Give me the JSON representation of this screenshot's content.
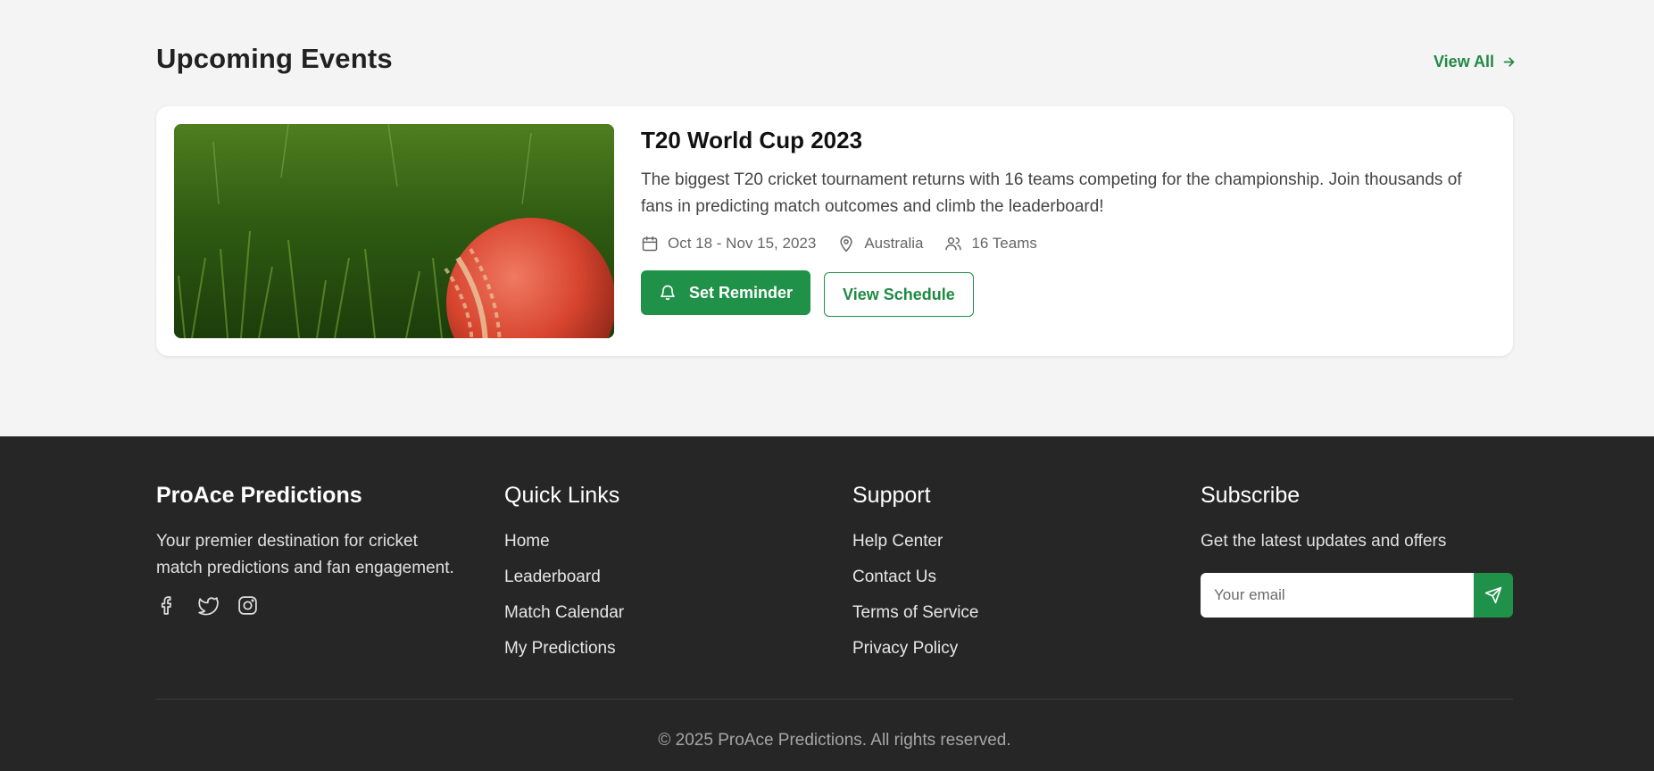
{
  "events": {
    "section_title": "Upcoming Events",
    "view_all_label": "View All",
    "card": {
      "title": "T20 World Cup 2023",
      "description": "The biggest T20 cricket tournament returns with 16 teams competing for the championship. Join thousands of fans in predicting match outcomes and climb the leaderboard!",
      "dates": "Oct 18 - Nov 15, 2023",
      "location": "Australia",
      "teams": "16 Teams",
      "primary_button": "Set Reminder",
      "secondary_button": "View Schedule"
    }
  },
  "footer": {
    "brand": {
      "name": "ProAce Predictions",
      "description": "Your premier destination for cricket match predictions and fan engagement.",
      "socials": [
        "facebook-icon",
        "twitter-icon",
        "instagram-icon"
      ]
    },
    "quick_links": {
      "title": "Quick Links",
      "items": [
        "Home",
        "Leaderboard",
        "Match Calendar",
        "My Predictions"
      ]
    },
    "support": {
      "title": "Support",
      "items": [
        "Help Center",
        "Contact Us",
        "Terms of Service",
        "Privacy Policy"
      ]
    },
    "subscribe": {
      "title": "Subscribe",
      "text": "Get the latest updates and offers",
      "placeholder": "Your email"
    },
    "copyright": "© 2025 ProAce Predictions. All rights reserved."
  },
  "colors": {
    "accent": "#1f9148",
    "footer_bg": "#262626",
    "page_bg": "#f4f4f4"
  }
}
